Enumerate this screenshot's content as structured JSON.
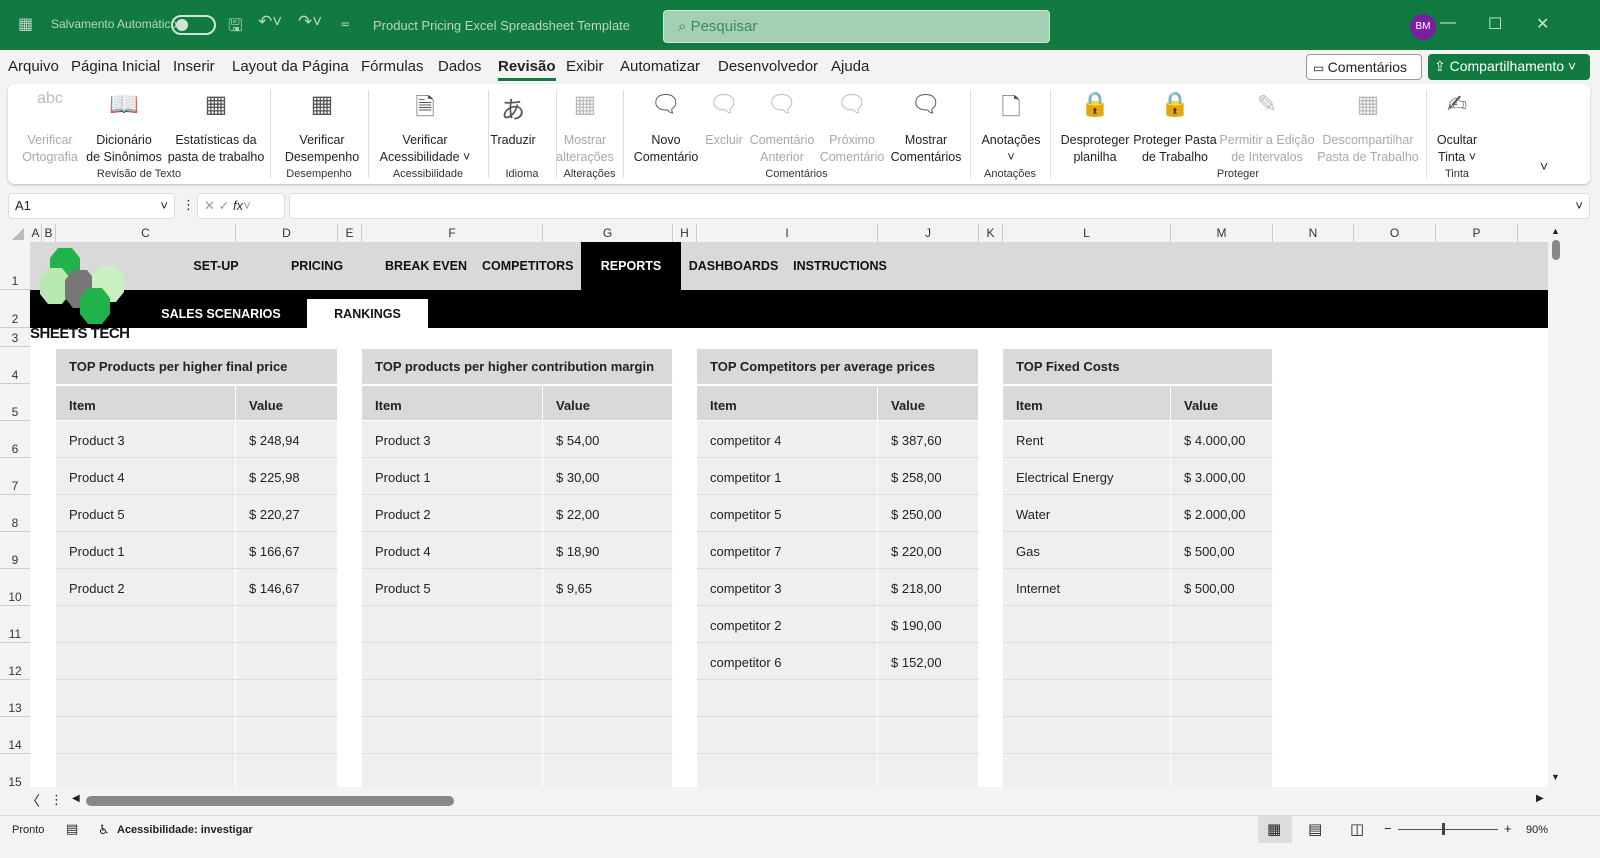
{
  "titlebar": {
    "autosave": "Salvamento Automático",
    "doc_title": "Product Pricing Excel Spreadsheet Template",
    "search_placeholder": "Pesquisar",
    "avatar": "BM"
  },
  "menu": [
    "Arquivo",
    "Página Inicial",
    "Inserir",
    "Layout da Página",
    "Fórmulas",
    "Dados",
    "Revisão",
    "Exibir",
    "Automatizar",
    "Desenvolvedor",
    "Ajuda"
  ],
  "active_menu": "Revisão",
  "comments_btn": "Comentários",
  "share_btn": "Compartilhamento",
  "ribbon": {
    "buttons": [
      {
        "l1": "Verificar",
        "l2": "Ortografia",
        "dis": true,
        "icon": "spellcheck-icon",
        "g": "abc"
      },
      {
        "l1": "Dicionário",
        "l2": "de Sinônimos",
        "icon": "thesaurus-icon",
        "g": "📖"
      },
      {
        "l1": "Estatísticas da",
        "l2": "pasta de trabalho",
        "icon": "workbook-stats-icon",
        "g": "▦"
      },
      {
        "l1": "Verificar",
        "l2": "Desempenho",
        "icon": "performance-icon",
        "g": "▦"
      },
      {
        "l1": "Verificar",
        "l2": "Acessibilidade ˅",
        "icon": "accessibility-icon",
        "g": "🗎"
      },
      {
        "l1": "Traduzir",
        "l2": "",
        "icon": "translate-icon",
        "g": "あ"
      },
      {
        "l1": "Mostrar",
        "l2": "alterações",
        "dis": true,
        "icon": "show-changes-icon",
        "g": "▦"
      },
      {
        "l1": "Novo",
        "l2": "Comentário",
        "icon": "new-comment-icon",
        "g": "🗨"
      },
      {
        "l1": "Excluir",
        "l2": "",
        "dis": true,
        "icon": "delete-comment-icon",
        "g": "🗨"
      },
      {
        "l1": "Comentário",
        "l2": "Anterior",
        "dis": true,
        "icon": "previous-comment-icon",
        "g": "🗨"
      },
      {
        "l1": "Próximo",
        "l2": "Comentário",
        "dis": true,
        "icon": "next-comment-icon",
        "g": "🗨"
      },
      {
        "l1": "Mostrar",
        "l2": "Comentários",
        "icon": "show-comments-icon",
        "g": "🗨"
      },
      {
        "l1": "Anotações",
        "l2": "˅",
        "icon": "notes-icon",
        "g": "🗋"
      },
      {
        "l1": "Desproteger",
        "l2": "planilha",
        "icon": "unprotect-sheet-icon",
        "g": "🔒"
      },
      {
        "l1": "Proteger Pasta",
        "l2": "de Trabalho",
        "icon": "protect-workbook-icon",
        "g": "🔒"
      },
      {
        "l1": "Permitir a Edição",
        "l2": "de Intervalos",
        "dis": true,
        "icon": "allow-edit-ranges-icon",
        "g": "✎"
      },
      {
        "l1": "Descompartilhar",
        "l2": "Pasta de Trabalho",
        "dis": true,
        "icon": "unshare-workbook-icon",
        "g": "▦"
      },
      {
        "l1": "Ocultar",
        "l2": "Tinta ˅",
        "icon": "hide-ink-icon",
        "g": "✍"
      }
    ],
    "groups": [
      "Revisão de Texto",
      "Desempenho",
      "Acessibilidade",
      "Idioma",
      "Alterações",
      "Comentários",
      "Anotações",
      "Proteger",
      "Tinta"
    ]
  },
  "formula_bar": {
    "name_box": "A1",
    "formula": ""
  },
  "columns": [
    "A",
    "B",
    "C",
    "D",
    "E",
    "F",
    "G",
    "H",
    "I",
    "J",
    "K",
    "L",
    "M",
    "N",
    "O",
    "P"
  ],
  "rows": [
    "1",
    "2",
    "3",
    "4",
    "5",
    "6",
    "7",
    "8",
    "9",
    "10",
    "11",
    "12",
    "13",
    "14",
    "15"
  ],
  "nav": {
    "top": [
      "SET-UP",
      "PRICING",
      "BREAK EVEN",
      "COMPETITORS",
      "REPORTS",
      "DASHBOARDS",
      "INSTRUCTIONS"
    ],
    "active": "REPORTS",
    "sub": [
      "SALES SCENARIOS",
      "RANKINGS"
    ],
    "logo": "SHEETS TECH"
  },
  "tables": [
    {
      "title": "TOP Products per higher final price",
      "h1": "Item",
      "h2": "Value",
      "rows": [
        [
          "Product 3",
          "$ 248,94"
        ],
        [
          "Product 4",
          "$ 225,98"
        ],
        [
          "Product 5",
          "$ 220,27"
        ],
        [
          "Product 1",
          "$ 166,67"
        ],
        [
          "Product 2",
          "$ 146,67"
        ]
      ]
    },
    {
      "title": "TOP products per higher contribution margin",
      "h1": "Item",
      "h2": "Value",
      "rows": [
        [
          "Product 3",
          "$ 54,00"
        ],
        [
          "Product 1",
          "$ 30,00"
        ],
        [
          "Product 2",
          "$ 22,00"
        ],
        [
          "Product 4",
          "$ 18,90"
        ],
        [
          "Product 5",
          "$ 9,65"
        ]
      ]
    },
    {
      "title": "TOP Competitors per average prices",
      "h1": "Item",
      "h2": "Value",
      "rows": [
        [
          "competitor 4",
          "$ 387,60"
        ],
        [
          "competitor 1",
          "$ 258,00"
        ],
        [
          "competitor 5",
          "$ 250,00"
        ],
        [
          "competitor 7",
          "$ 220,00"
        ],
        [
          "competitor 3",
          "$ 218,00"
        ],
        [
          "competitor 2",
          "$ 190,00"
        ],
        [
          "competitor 6",
          "$ 152,00"
        ]
      ]
    },
    {
      "title": "TOP Fixed Costs",
      "h1": "Item",
      "h2": "Value",
      "rows": [
        [
          "Rent",
          "$ 4.000,00"
        ],
        [
          "Electrical Energy",
          "$ 3.000,00"
        ],
        [
          "Water",
          "$ 2.000,00"
        ],
        [
          "Gas",
          "$ 500,00"
        ],
        [
          "Internet",
          "$ 500,00"
        ]
      ]
    }
  ],
  "status": {
    "ready": "Pronto",
    "accessibility": "Acessibilidade: investigar",
    "zoom": "90%"
  }
}
